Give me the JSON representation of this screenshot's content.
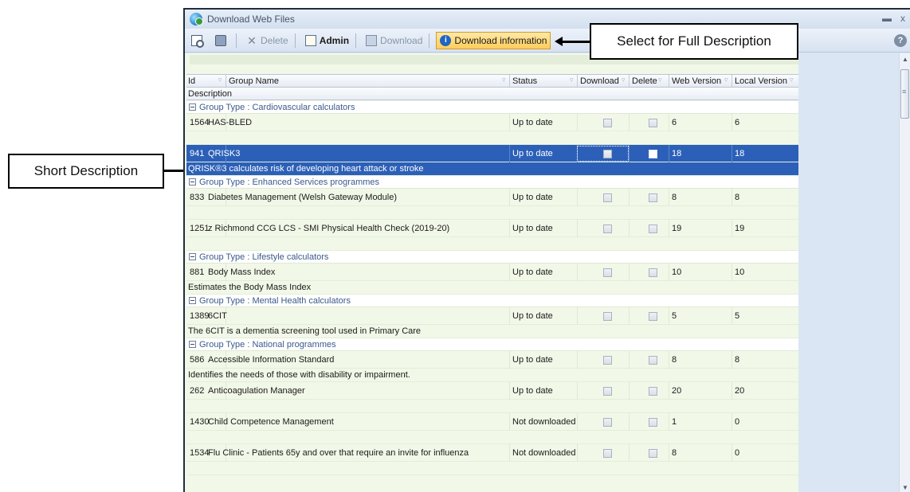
{
  "window": {
    "title": "Download Web Files",
    "help_glyph": "?",
    "minimize_glyph": "▬",
    "close_glyph": "x"
  },
  "toolbar": {
    "delete_label": "Delete",
    "admin_label": "Admin",
    "download_label": "Download",
    "download_info_label": "Download information",
    "info_glyph": "i",
    "delete_glyph": "✕"
  },
  "columns": {
    "id": "Id",
    "group_name": "Group Name",
    "status": "Status",
    "download": "Download",
    "delete": "Delete",
    "web_version": "Web Version",
    "local_version": "Local Version",
    "description": "Description",
    "filter_glyph": "▿"
  },
  "groups": [
    {
      "label": "Group Type : Cardiovascular calculators",
      "items": [
        {
          "id": "1564",
          "name": "HAS-BLED",
          "status": "Up to date",
          "web": "6",
          "local": "6",
          "description": ""
        },
        {
          "id": "941",
          "name": "QRISK3",
          "status": "Up to date",
          "web": "18",
          "local": "18",
          "description": "QRISK®3 calculates risk of developing heart attack or stroke",
          "selected": true
        }
      ]
    },
    {
      "label": "Group Type : Enhanced Services programmes",
      "items": [
        {
          "id": "833",
          "name": "Diabetes Management (Welsh Gateway Module)",
          "status": "Up to date",
          "web": "8",
          "local": "8",
          "description": ""
        },
        {
          "id": "1251",
          "name": "z Richmond CCG LCS - SMI Physical Health Check (2019-20)",
          "status": "Up to date",
          "web": "19",
          "local": "19",
          "description": ""
        }
      ]
    },
    {
      "label": "Group Type : Lifestyle calculators",
      "items": [
        {
          "id": "881",
          "name": "Body Mass Index",
          "status": "Up to date",
          "web": "10",
          "local": "10",
          "description": "Estimates the Body Mass Index"
        }
      ]
    },
    {
      "label": "Group Type : Mental Health calculators",
      "items": [
        {
          "id": "1389",
          "name": "6CIT",
          "status": "Up to date",
          "web": "5",
          "local": "5",
          "description": "The 6CIT is a dementia screening tool used in Primary Care"
        }
      ]
    },
    {
      "label": "Group Type : National programmes",
      "items": [
        {
          "id": "586",
          "name": "Accessible Information Standard",
          "status": "Up to date",
          "web": "8",
          "local": "8",
          "description": "Identifies the needs of those with disability or impairment."
        },
        {
          "id": "262",
          "name": "Anticoagulation Manager",
          "status": "Up to date",
          "web": "20",
          "local": "20",
          "description": ""
        },
        {
          "id": "1430",
          "name": "Child Competence Management",
          "status": "Not downloaded",
          "web": "1",
          "local": "0",
          "description": ""
        },
        {
          "id": "1534",
          "name": "Flu Clinic - Patients 65y and over that require an invite for influenza",
          "status": "Not downloaded",
          "web": "8",
          "local": "0",
          "description": ""
        }
      ]
    }
  ],
  "callouts": {
    "full_description": "Select for Full Description",
    "short_description": "Short Description"
  }
}
